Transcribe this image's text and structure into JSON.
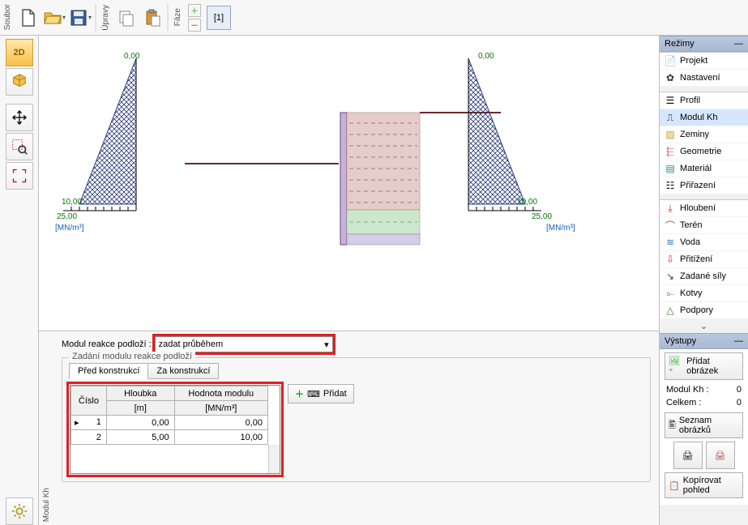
{
  "toolbar": {
    "soubor_label": "Soubor",
    "upravy_label": "Úpravy",
    "faze_label": "Fáze",
    "phase_tab": "[1]"
  },
  "rezimy": {
    "title": "Režimy",
    "groups": {
      "g1": [
        {
          "icon": "file",
          "label": "Projekt"
        },
        {
          "icon": "gear",
          "label": "Nastavení"
        }
      ],
      "g2": [
        {
          "icon": "profile",
          "label": "Profil"
        },
        {
          "icon": "modul",
          "label": "Modul Kh",
          "selected": true
        },
        {
          "icon": "zeminy",
          "label": "Zeminy"
        },
        {
          "icon": "geom",
          "label": "Geometrie"
        },
        {
          "icon": "mat",
          "label": "Materiál"
        },
        {
          "icon": "assign",
          "label": "Přiřazení"
        }
      ],
      "g3": [
        {
          "icon": "dig",
          "label": "Hloubení"
        },
        {
          "icon": "terrain",
          "label": "Terén"
        },
        {
          "icon": "water",
          "label": "Voda"
        },
        {
          "icon": "load",
          "label": "Přitížení"
        },
        {
          "icon": "force",
          "label": "Zadané síly"
        },
        {
          "icon": "anchor",
          "label": "Kotvy"
        },
        {
          "icon": "support",
          "label": "Podpory"
        }
      ]
    }
  },
  "vystupy": {
    "title": "Výstupy",
    "add_image": "Přidat obrázek",
    "modul_label": "Modul Kh :",
    "modul_val": "0",
    "celkem_label": "Celkem :",
    "celkem_val": "0",
    "list_images": "Seznam obrázků",
    "copy_view": "Kopírovat pohled"
  },
  "form": {
    "module_label": "Modul reakce podloží :",
    "module_value": "zadat průběhem",
    "fieldset_title": "Zadání modulu reakce podloží",
    "tab_before": "Před konstrukcí",
    "tab_after": "Za konstrukcí",
    "add_button": "Přidat",
    "side_label": "Modul Kh",
    "th_number": "Číslo",
    "th_depth": "Hloubka",
    "th_depth_unit": "[m]",
    "th_value": "Hodnota modulu",
    "th_value_unit": "[MN/m³]",
    "rows": [
      {
        "n": "1",
        "depth": "0,00",
        "val": "0,00",
        "selected": true
      },
      {
        "n": "2",
        "depth": "5,00",
        "val": "10,00"
      }
    ]
  },
  "chart_data": {
    "type": "line",
    "title": "",
    "xlabel": "[MN/m³]",
    "ylabel": "depth",
    "series": [
      {
        "name": "Left side (před konstrukcí)",
        "x": [
          0,
          25
        ],
        "y": [
          0,
          10
        ],
        "xrange": [
          0,
          25
        ],
        "yrange": [
          0,
          10
        ]
      },
      {
        "name": "Right side (za konstrukcí)",
        "x": [
          0,
          25
        ],
        "y": [
          0,
          10
        ],
        "xrange": [
          0,
          25
        ],
        "yrange": [
          0,
          10
        ]
      }
    ],
    "top_labels": [
      "0,00",
      "0,00"
    ],
    "depth_labels": [
      "10,00",
      "10,00"
    ],
    "axis_end_labels": [
      "25,00",
      "25,00"
    ],
    "unit": "[MN/m³]"
  }
}
